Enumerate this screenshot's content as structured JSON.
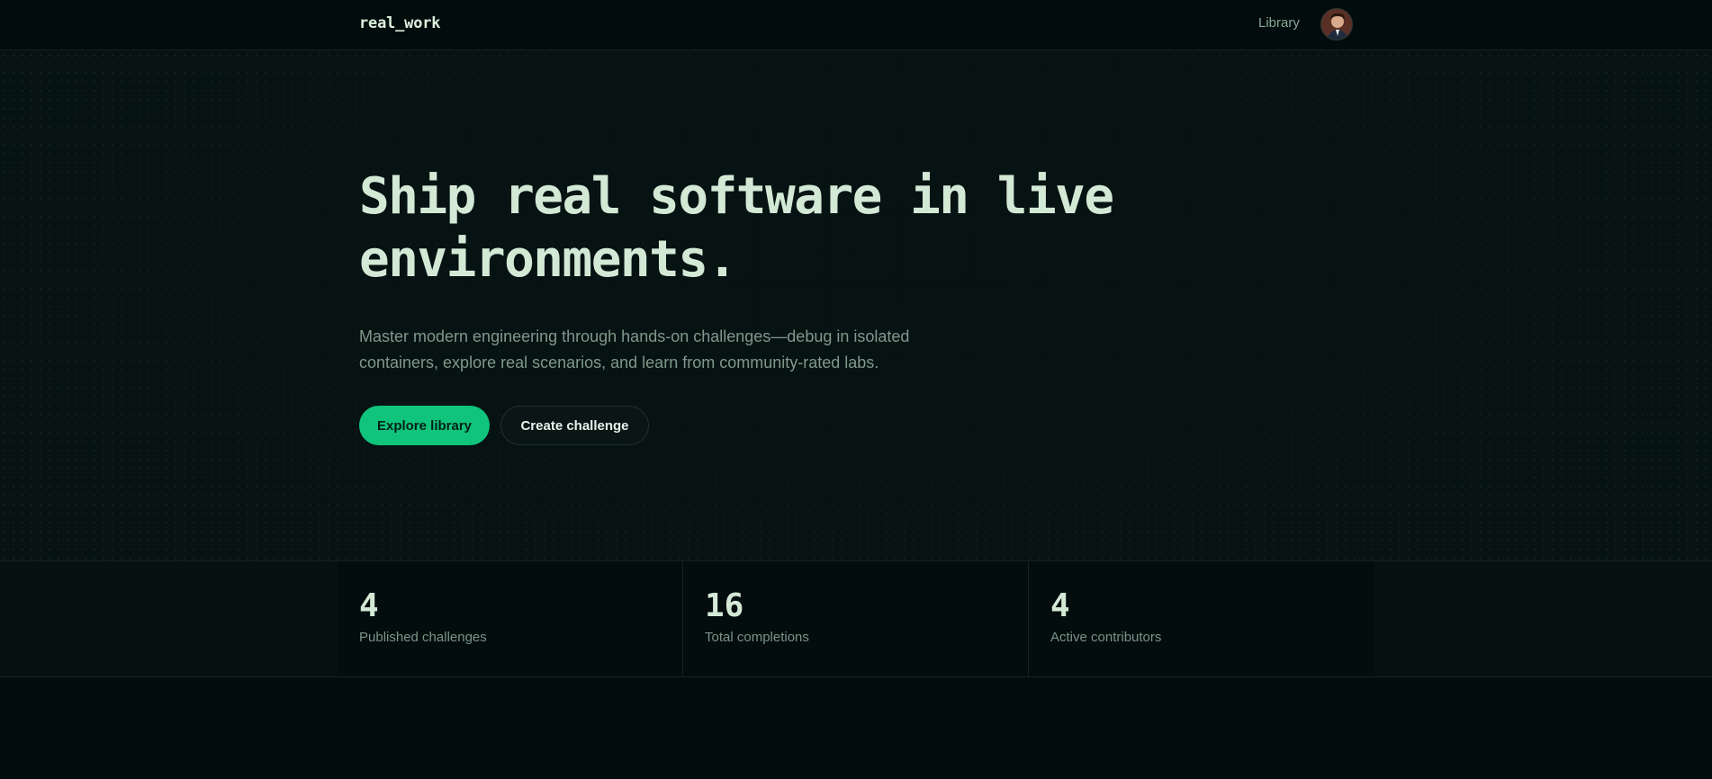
{
  "header": {
    "brand": "real_work",
    "nav_library": "Library",
    "avatar_icon": "user-avatar"
  },
  "hero": {
    "title": "Ship real software in live environments.",
    "subtitle": "Master modern engineering through hands-on challenges—debug in isolated containers, explore real scenarios, and learn from community-rated labs.",
    "primary_button": "Explore library",
    "secondary_button": "Create challenge"
  },
  "stats": [
    {
      "value": "4",
      "label": "Published challenges"
    },
    {
      "value": "16",
      "label": "Total completions"
    },
    {
      "value": "4",
      "label": "Active contributors"
    }
  ],
  "colors": {
    "background": "#030c0d",
    "accent": "#10c47c",
    "heading_text": "#d3e9d6",
    "muted_text": "#80998b"
  }
}
